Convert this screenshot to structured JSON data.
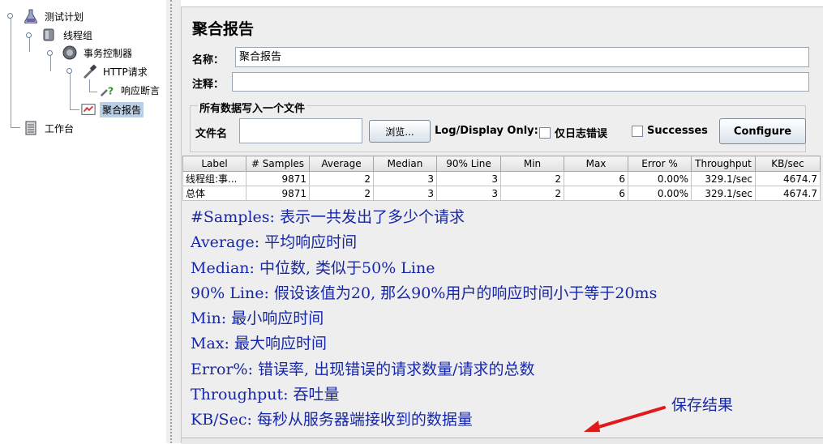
{
  "tree": {
    "items": [
      {
        "label": "测试计划"
      },
      {
        "label": "线程组"
      },
      {
        "label": "事务控制器"
      },
      {
        "label": "HTTP请求"
      },
      {
        "label": "响应断言"
      },
      {
        "label": "聚合报告"
      },
      {
        "label": "工作台"
      }
    ]
  },
  "panel": {
    "title": "聚合报告",
    "name_label": "名称：",
    "name_value": "聚合报告",
    "comment_label": "注释：",
    "comment_value": "",
    "file_section_title": "所有数据写入一个文件",
    "file_label": "文件名",
    "file_value": "",
    "browse_label": "浏览...",
    "log_display_label": "Log/Display Only:",
    "errors_only_label": "仅日志错误",
    "successes_label": "Successes",
    "configure_label": "Configure"
  },
  "table": {
    "headers": [
      "Label",
      "# Samples",
      "Average",
      "Median",
      "90% Line",
      "Min",
      "Max",
      "Error %",
      "Throughput",
      "KB/sec"
    ],
    "rows": [
      [
        "线程组:事...",
        "9871",
        "2",
        "3",
        "3",
        "2",
        "6",
        "0.00%",
        "329.1/sec",
        "4674.7"
      ],
      [
        "总体",
        "9871",
        "2",
        "3",
        "3",
        "2",
        "6",
        "0.00%",
        "329.1/sec",
        "4674.7"
      ]
    ]
  },
  "annotations": [
    "#Samples: 表示一共发出了多少个请求",
    "Average: 平均响应时间",
    "Median: 中位数, 类似于50% Line",
    "90% Line: 假设该值为20, 那么90%用户的响应时间小于等于20ms",
    "Min: 最小响应时间",
    "Max: 最大响应时间",
    "Error%: 错误率, 出现错误的请求数量/请求的总数",
    "Throughput: 吞吐量",
    "KB/Sec: 每秒从服务器端接收到的数据量"
  ],
  "save_note": "保存结果",
  "colors": {
    "annotation": "#1727a6",
    "arrow": "#e01a1a",
    "selection": "#b9cfe5"
  }
}
